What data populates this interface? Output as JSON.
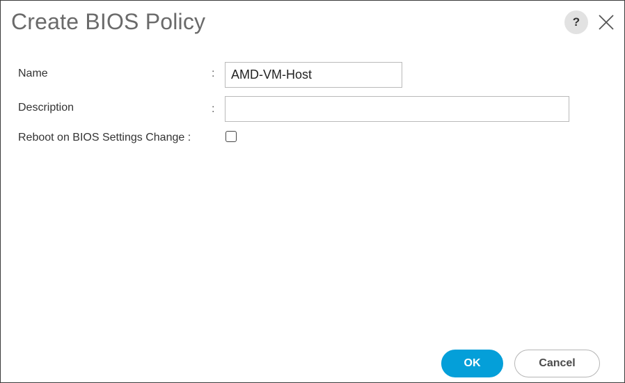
{
  "dialog": {
    "title": "Create BIOS Policy",
    "help_label": "?",
    "close_icon": "close-icon"
  },
  "form": {
    "name": {
      "label": "Name",
      "separator": ":",
      "value": "AMD-VM-Host"
    },
    "description": {
      "label": "Description",
      "separator": ":",
      "value": ""
    },
    "reboot": {
      "label": "Reboot on BIOS Settings Change :",
      "checked": false
    }
  },
  "footer": {
    "ok_label": "OK",
    "cancel_label": "Cancel"
  },
  "colors": {
    "accent": "#049fd9",
    "title": "#6a6a6a"
  }
}
